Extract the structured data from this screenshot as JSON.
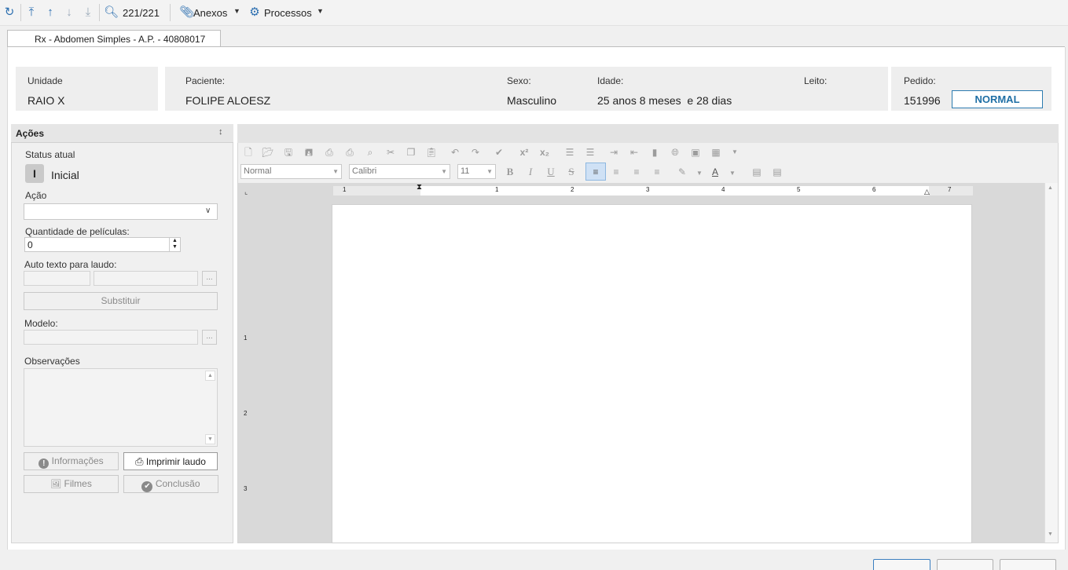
{
  "toolbar": {
    "record_counter": "221/221",
    "anexos_label": "Anexos",
    "processos_label": "Processos"
  },
  "tab": {
    "label": "Rx - Abdomen Simples - A.P. - 40808017"
  },
  "header": {
    "unidade_label": "Unidade",
    "unidade_value": "RAIO X",
    "paciente_label": "Paciente:",
    "paciente_value": "FOLIPE ALOESZ",
    "sexo_label": "Sexo:",
    "sexo_value": "Masculino",
    "idade_label": "Idade:",
    "idade_value": "25 anos 8 meses  e 28 dias",
    "leito_label": "Leito:",
    "pedido_label": "Pedido:",
    "pedido_value": "151996",
    "priority_badge": "NORMAL",
    "badge_color": "#1f6fa5"
  },
  "actions": {
    "title": "Ações",
    "status_label": "Status atual",
    "status_letter": "I",
    "status_value": "Inicial",
    "acao_label": "Ação",
    "acao_value": "",
    "peliculas_label": "Quantidade de películas:",
    "peliculas_value": "0",
    "autotexto_label": "Auto texto para laudo:",
    "ellipsis": "...",
    "substituir_label": "Substituir",
    "modelo_label": "Modelo:",
    "observacoes_label": "Observações",
    "informacoes_label": "Informações",
    "imprimir_label": "Imprimir laudo",
    "filmes_label": "Filmes",
    "conclusao_label": "Conclusão"
  },
  "editor": {
    "style_value": "Normal",
    "font_value": "Calibri",
    "size_value": "11",
    "superscript": "x²",
    "subscript": "x₂",
    "bold": "B",
    "italic": "I",
    "underline": "U",
    "strike": "S",
    "font_color": "A",
    "ruler_numbers": [
      "1",
      "1",
      "2",
      "3",
      "4",
      "5",
      "6",
      "7"
    ],
    "vruler_numbers": [
      "1",
      "2",
      "3"
    ]
  }
}
